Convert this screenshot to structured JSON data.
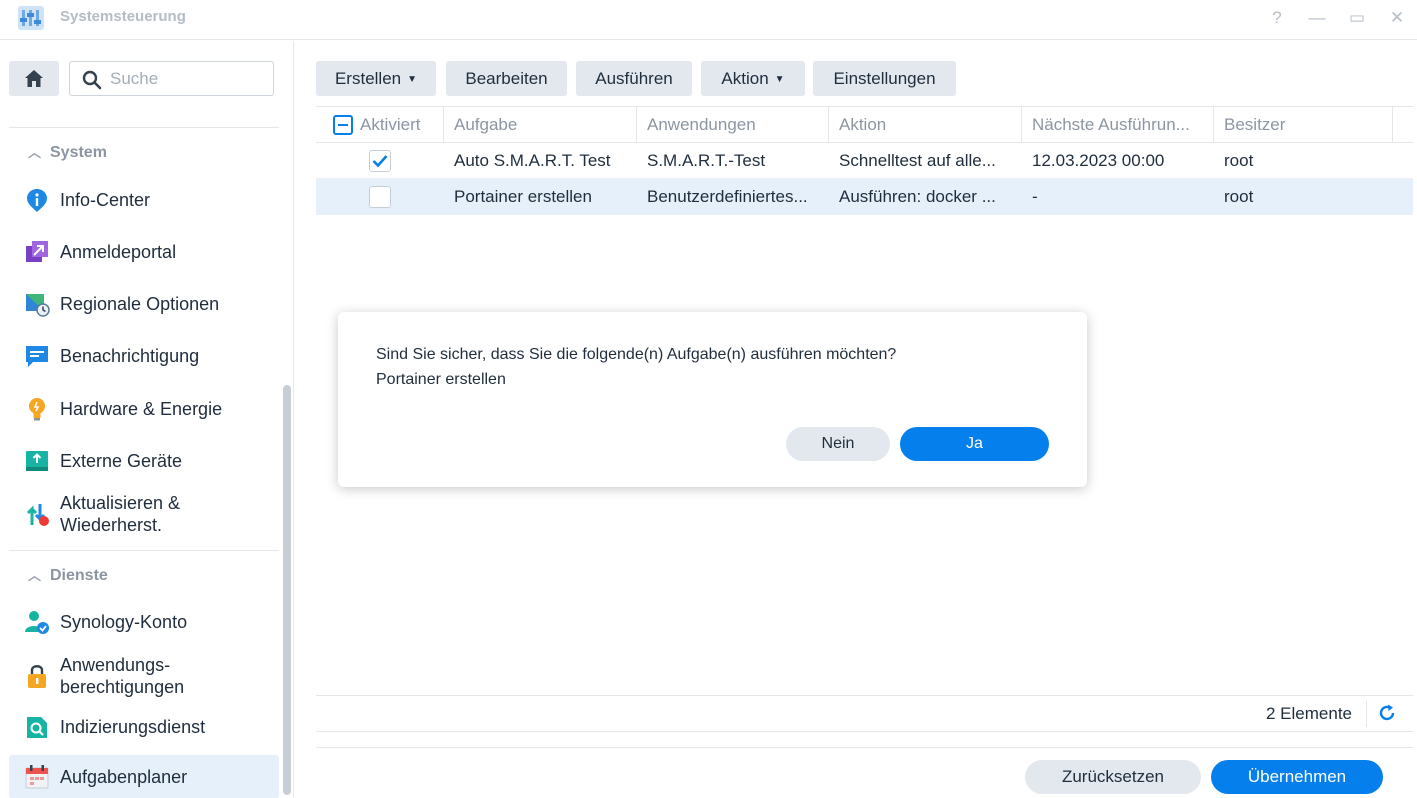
{
  "window": {
    "title": "Systemsteuerung",
    "help_icon": "?",
    "minimize_icon": "—",
    "maximize_icon": "▭",
    "close_icon": "✕"
  },
  "sidebar": {
    "search_placeholder": "Suche",
    "sections": [
      {
        "title": "System",
        "items": [
          {
            "label": "Info-Center",
            "icon": "info-icon"
          },
          {
            "label": "Anmeldeportal",
            "icon": "login-portal-icon"
          },
          {
            "label": "Regionale Optionen",
            "icon": "regional-options-icon"
          },
          {
            "label": "Benachrichtigung",
            "icon": "notification-icon"
          },
          {
            "label": "Hardware & Energie",
            "icon": "hardware-energy-icon"
          },
          {
            "label": "Externe Geräte",
            "icon": "external-devices-icon"
          },
          {
            "label": "Aktualisieren & Wiederherst.",
            "icon": "update-restore-icon"
          }
        ]
      },
      {
        "title": "Dienste",
        "items": [
          {
            "label": "Synology-Konto",
            "icon": "synology-account-icon"
          },
          {
            "label": "Anwendungs-berechtigungen",
            "icon": "app-privileges-icon"
          },
          {
            "label": "Indizierungsdienst",
            "icon": "indexing-service-icon"
          },
          {
            "label": "Aufgabenplaner",
            "icon": "task-scheduler-icon",
            "active": true
          }
        ]
      }
    ],
    "wrapped_labels": {
      "update_line1": "Aktualisieren &",
      "update_line2": "Wiederherst.",
      "privileges_line1": "Anwendungs-",
      "privileges_line2": "berechtigungen"
    }
  },
  "toolbar": {
    "create": "Erstellen",
    "edit": "Bearbeiten",
    "run": "Ausführen",
    "action": "Aktion",
    "settings": "Einstellungen"
  },
  "table": {
    "columns": [
      "Aktiviert",
      "Aufgabe",
      "Anwendungen",
      "Aktion",
      "Nächste Ausführun...",
      "Besitzer"
    ],
    "rows": [
      {
        "enabled": true,
        "task": "Auto S.M.A.R.T. Test",
        "application": "S.M.A.R.T.-Test",
        "action": "Schnelltest auf alle...",
        "next_run": "12.03.2023 00:00",
        "owner": "root",
        "selected": false
      },
      {
        "enabled": false,
        "task": "Portainer erstellen",
        "application": "Benutzerdefiniertes...",
        "action": "Ausführen: docker ...",
        "next_run": "-",
        "owner": "root",
        "selected": true
      }
    ],
    "item_count": "2 Elemente"
  },
  "footer": {
    "reset": "Zurücksetzen",
    "apply": "Übernehmen"
  },
  "dialog": {
    "message": "Sind Sie sicher, dass Sie die folgende(n) Aufgabe(n) ausführen möchten?",
    "task_name": "Portainer erstellen",
    "no": "Nein",
    "yes": "Ja"
  },
  "colors": {
    "accent": "#057feb",
    "selected_row": "#e6f0fb",
    "button_gray": "#e3e8ee"
  }
}
